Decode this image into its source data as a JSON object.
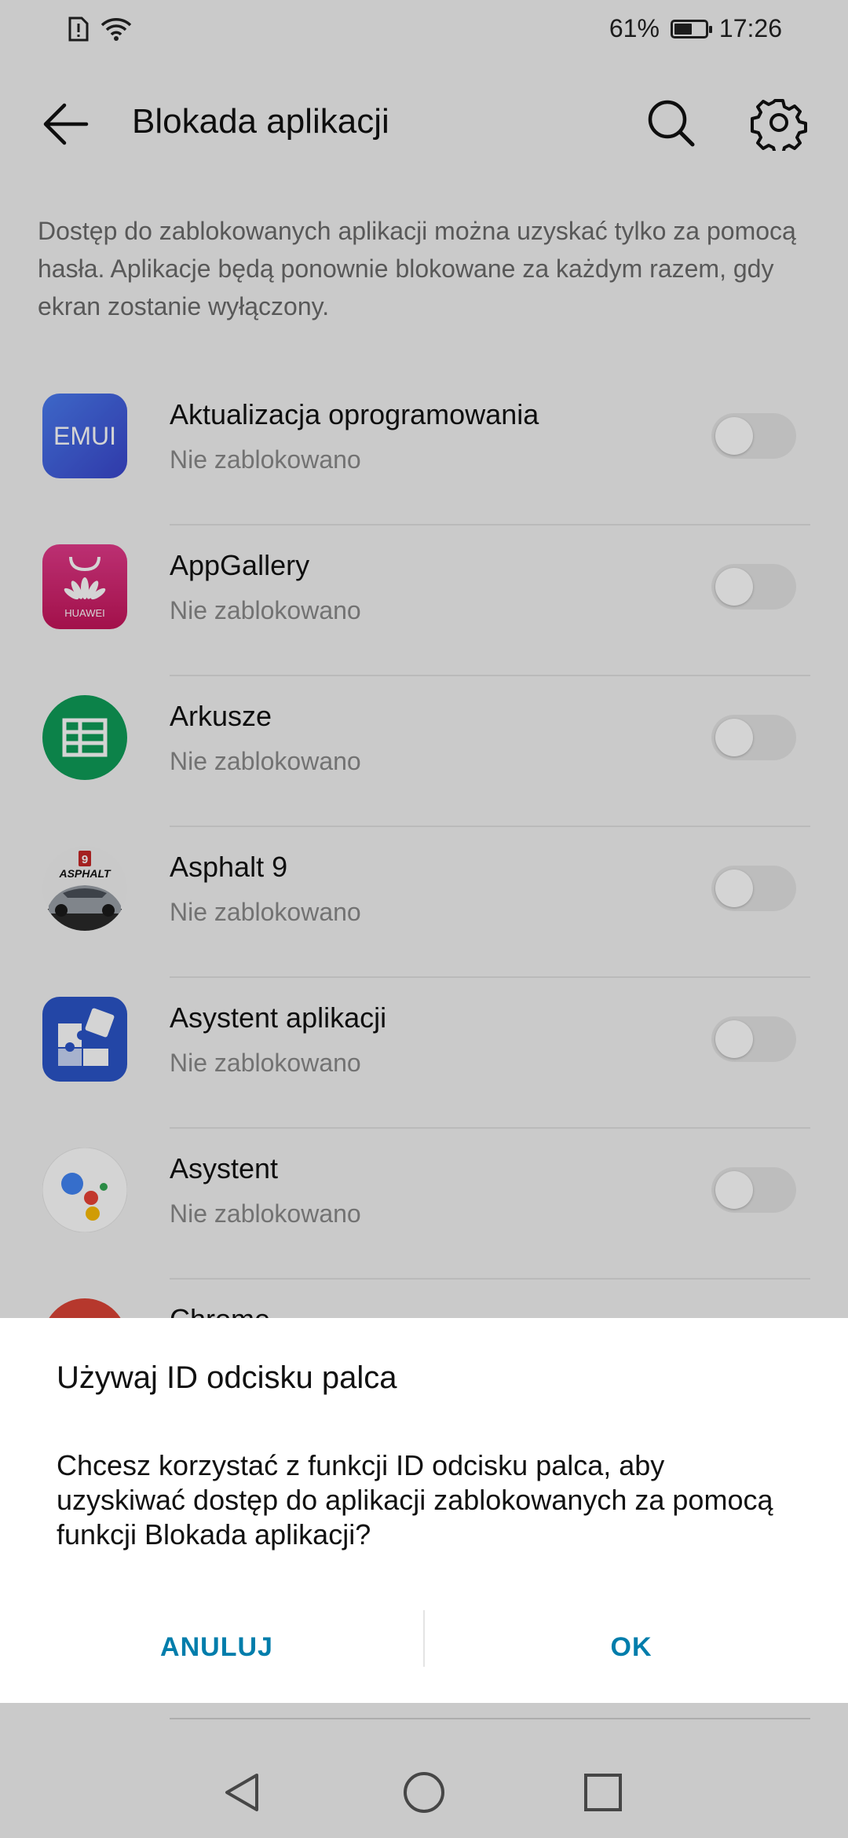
{
  "status_bar": {
    "battery_percent": "61%",
    "battery_level": 0.61,
    "time": "17:26"
  },
  "app_bar": {
    "title": "Blokada aplikacji"
  },
  "intro_text": "Dostęp do zablokowanych aplikacji można uzyskać tylko za pomocą hasła. Aplikacje będą ponownie blokowane za każdym razem, gdy ekran zostanie wyłączony.",
  "apps": [
    {
      "name": "Aktualizacja oprogramowania",
      "status": "Nie zablokowano",
      "icon": "emui-icon",
      "locked": false
    },
    {
      "name": "AppGallery",
      "status": "Nie zablokowano",
      "icon": "appgallery-icon",
      "locked": false
    },
    {
      "name": "Arkusze",
      "status": "Nie zablokowano",
      "icon": "sheets-icon",
      "locked": false
    },
    {
      "name": "Asphalt 9",
      "status": "Nie zablokowano",
      "icon": "asphalt-icon",
      "locked": false
    },
    {
      "name": "Asystent aplikacji",
      "status": "Nie zablokowano",
      "icon": "app-assistant-icon",
      "locked": false
    },
    {
      "name": "Asystent",
      "status": "Nie zablokowano",
      "icon": "google-assistant-icon",
      "locked": false
    },
    {
      "name": "Chrome",
      "status": "",
      "icon": "chrome-icon",
      "locked": false
    }
  ],
  "icon_text": {
    "emui": "EMUI",
    "huawei": "HUAWEI",
    "asphalt_badge": "9",
    "asphalt": "ASPHALT"
  },
  "dialog": {
    "title": "Używaj ID odcisku palca",
    "message": "Chcesz korzystać z funkcji ID odcisku palca, aby uzyskiwać dostęp do aplikacji zablokowanych za pomocą funkcji Blokada aplikacji?",
    "cancel_label": "ANULUJ",
    "ok_label": "OK"
  },
  "colors": {
    "accent": "#007dab",
    "emui": "#3a56d8",
    "appgallery": "#d81b60",
    "sheets": "#0f9d58",
    "app_assistant": "#2b55c8",
    "chrome": "#db4437"
  }
}
